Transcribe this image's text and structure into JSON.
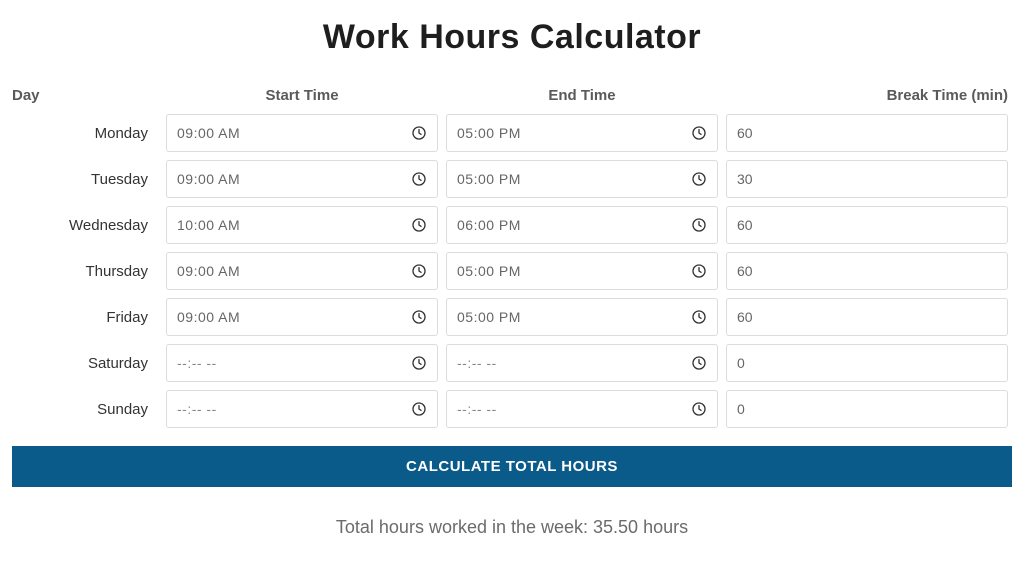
{
  "title": "Work Hours Calculator",
  "headers": {
    "day": "Day",
    "start": "Start Time",
    "end": "End Time",
    "break": "Break Time (min)"
  },
  "days": [
    {
      "name": "Monday",
      "start": "09:00 AM",
      "end": "05:00 PM",
      "break": "60"
    },
    {
      "name": "Tuesday",
      "start": "09:00 AM",
      "end": "05:00 PM",
      "break": "30"
    },
    {
      "name": "Wednesday",
      "start": "10:00 AM",
      "end": "06:00 PM",
      "break": "60"
    },
    {
      "name": "Thursday",
      "start": "09:00 AM",
      "end": "05:00 PM",
      "break": "60"
    },
    {
      "name": "Friday",
      "start": "09:00 AM",
      "end": "05:00 PM",
      "break": "60"
    },
    {
      "name": "Saturday",
      "start": "--:-- --",
      "end": "--:-- --",
      "break": "0"
    },
    {
      "name": "Sunday",
      "start": "--:-- --",
      "end": "--:-- --",
      "break": "0"
    }
  ],
  "button_label": "CALCULATE TOTAL HOURS",
  "result_text": "Total hours worked in the week: 35.50 hours",
  "colors": {
    "primary_button": "#0a5a8a"
  }
}
